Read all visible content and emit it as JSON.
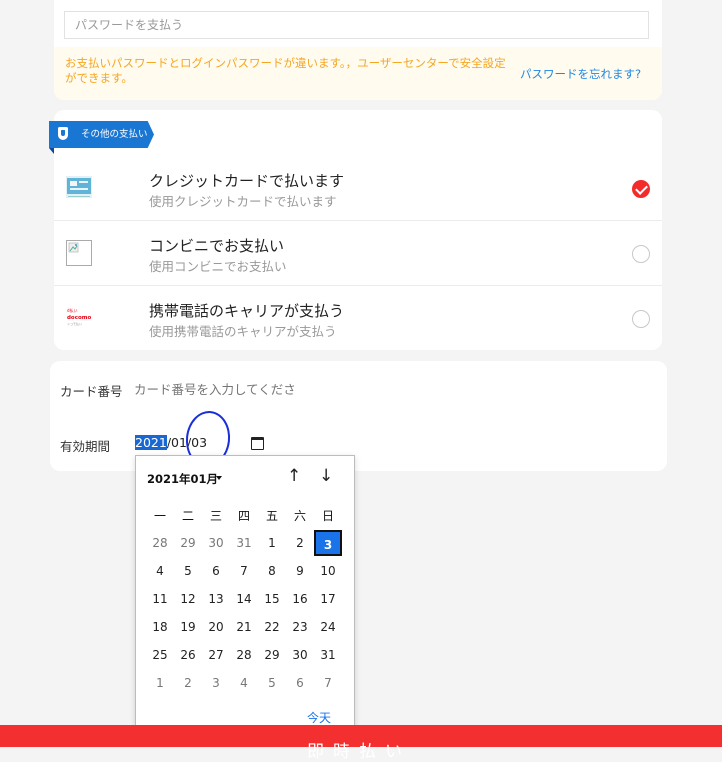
{
  "password": {
    "placeholder": "パスワードを支払う",
    "warning": "お支払いパスワードとログインパスワードが違います。，ユーザーセンターで安全設定ができます。",
    "forgot_link": "パスワードを忘れます?"
  },
  "other_payment": {
    "tag_label": "その他の支払い",
    "tag_color": "#1976d2",
    "methods": [
      {
        "icon": "credit-card-icon",
        "title": "クレジットカードで払います",
        "subtitle": "使用クレジットカードで払います",
        "selected": true
      },
      {
        "icon": "broken-image-icon",
        "title": "コンビニでお支払い",
        "subtitle": "使用コンビニでお支払い",
        "selected": false
      },
      {
        "icon": "docomo-logo-icon",
        "title": "携帯電話のキャリアが支払う",
        "subtitle": "使用携帯電話のキャリアが支払う",
        "selected": false
      }
    ]
  },
  "card_form": {
    "card_number_label": "カード番号",
    "card_number_placeholder": "カード番号を入力してくださ",
    "expiry_label": "有効期間",
    "expiry_year": "2021",
    "expiry_sep1": "/",
    "expiry_month": "01",
    "expiry_sep2": "/",
    "expiry_day": "03"
  },
  "date_picker": {
    "month_label": "2021年01月",
    "weekdays": [
      "一",
      "二",
      "三",
      "四",
      "五",
      "六",
      "日"
    ],
    "weeks": [
      [
        {
          "d": "28",
          "o": true
        },
        {
          "d": "29",
          "o": true
        },
        {
          "d": "30",
          "o": true
        },
        {
          "d": "31",
          "o": true
        },
        {
          "d": "1"
        },
        {
          "d": "2"
        },
        {
          "d": "3",
          "s": true
        }
      ],
      [
        {
          "d": "4"
        },
        {
          "d": "5"
        },
        {
          "d": "6"
        },
        {
          "d": "7"
        },
        {
          "d": "8"
        },
        {
          "d": "9"
        },
        {
          "d": "10"
        }
      ],
      [
        {
          "d": "11"
        },
        {
          "d": "12"
        },
        {
          "d": "13"
        },
        {
          "d": "14"
        },
        {
          "d": "15"
        },
        {
          "d": "16"
        },
        {
          "d": "17"
        }
      ],
      [
        {
          "d": "18"
        },
        {
          "d": "19"
        },
        {
          "d": "20"
        },
        {
          "d": "21"
        },
        {
          "d": "22"
        },
        {
          "d": "23"
        },
        {
          "d": "24"
        }
      ],
      [
        {
          "d": "25"
        },
        {
          "d": "26"
        },
        {
          "d": "27"
        },
        {
          "d": "28"
        },
        {
          "d": "29"
        },
        {
          "d": "30"
        },
        {
          "d": "31"
        }
      ],
      [
        {
          "d": "1",
          "o": true
        },
        {
          "d": "2",
          "o": true
        },
        {
          "d": "3",
          "o": true
        },
        {
          "d": "4",
          "o": true
        },
        {
          "d": "5",
          "o": true
        },
        {
          "d": "6",
          "o": true
        },
        {
          "d": "7",
          "o": true
        }
      ]
    ],
    "today_label": "今天",
    "accent_color": "#1a73e8"
  },
  "bottom_bar": {
    "label": "即時払い",
    "color": "#f42f2f"
  }
}
